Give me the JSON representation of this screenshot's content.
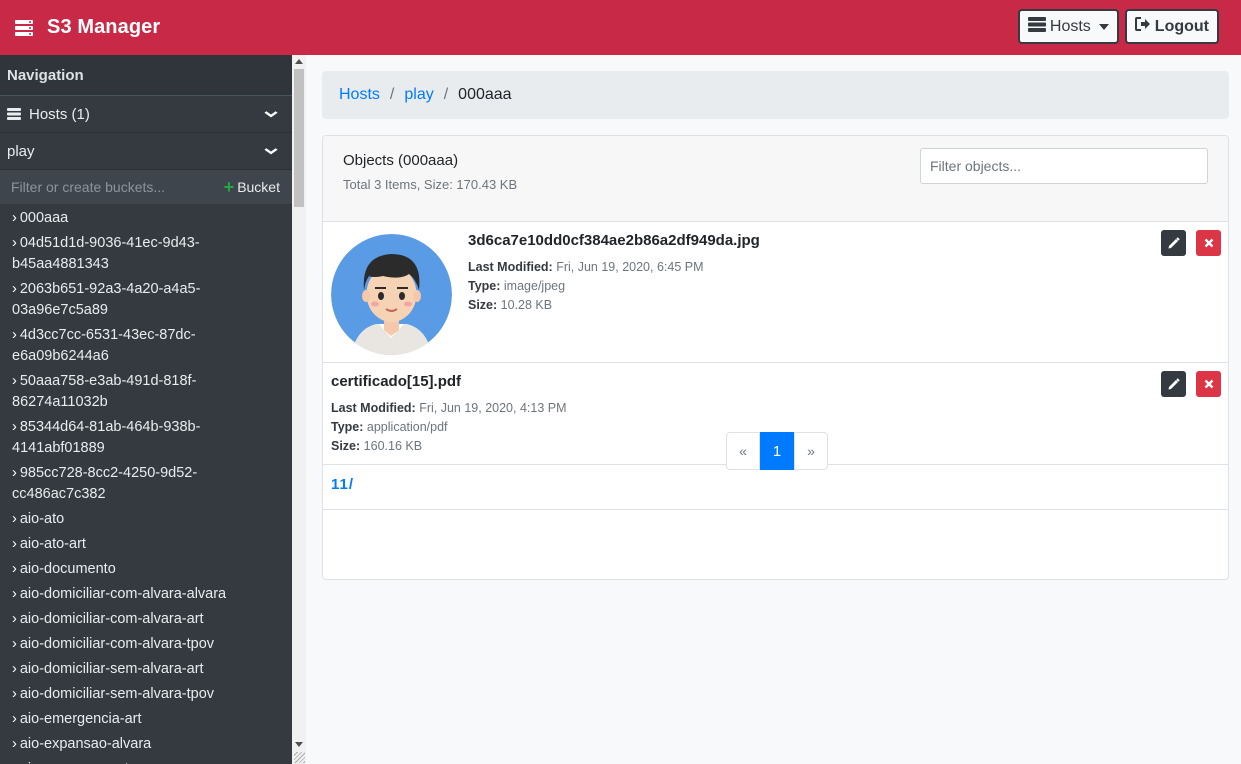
{
  "navbar": {
    "title": "S3 Manager",
    "hosts_label": "Hosts",
    "logout_label": "Logout",
    "brand_color": "#c82946"
  },
  "sidebar": {
    "heading": "Navigation",
    "hosts_label": "Hosts (1)",
    "host_name": "play",
    "filter_placeholder": "Filter or create buckets...",
    "bucket_button": "Bucket",
    "buckets": [
      "000aaa",
      "04d51d1d-9036-41ec-9d43-\nb45aa4881343",
      "2063b651-92a3-4a20-a4a5-\n03a96e7c5a89",
      "4d3cc7cc-6531-43ec-87dc-\ne6a09b6244a6",
      "50aaa758-e3ab-491d-818f-\n86274a11032b",
      "85344d64-81ab-464b-938b-\n4141abf01889",
      "985cc728-8cc2-4250-9d52-\ncc486ac7c382",
      "aio-ato",
      "aio-ato-art",
      "aio-documento",
      "aio-domiciliar-com-alvara-alvara",
      "aio-domiciliar-com-alvara-art",
      "aio-domiciliar-com-alvara-tpov",
      "aio-domiciliar-sem-alvara-art",
      "aio-domiciliar-sem-alvara-tpov",
      "aio-emergencia-art",
      "aio-expansao-alvara",
      "aio-expansao-art"
    ]
  },
  "breadcrumb": {
    "hosts": "Hosts",
    "host": "play",
    "bucket": "000aaa"
  },
  "objects": {
    "title": "Objects (000aaa)",
    "summary": "Total 3 Items, Size: 170.43 KB",
    "filter_placeholder": "Filter objects...",
    "labels": {
      "last_modified": "Last Modified:",
      "type": "Type:",
      "size": "Size:"
    },
    "items": [
      {
        "name": "3d6ca7e10dd0cf384ae2b86a2df949da.jpg",
        "last_modified": "Fri, Jun 19, 2020, 6:45 PM",
        "type": "image/jpeg",
        "size": "10.28 KB"
      },
      {
        "name": "certificado[15].pdf",
        "last_modified": "Fri, Jun 19, 2020, 4:13 PM",
        "type": "application/pdf",
        "size": "160.16 KB"
      }
    ],
    "folder": "11/"
  },
  "pagination": {
    "prev": "«",
    "current": "1",
    "next": "»"
  }
}
